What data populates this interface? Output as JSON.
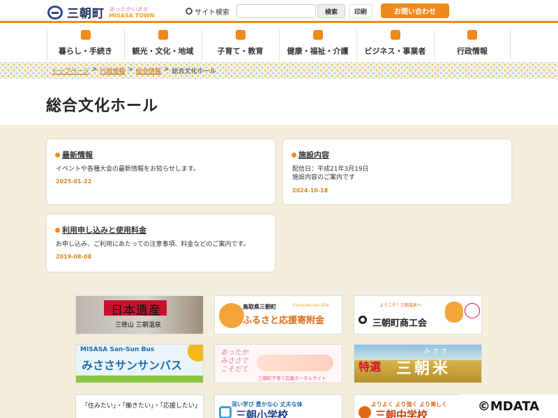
{
  "header": {
    "logo_text": "三朝町",
    "logo_sub1": "あったかいまち",
    "logo_sub2": "MISASA TOWN",
    "search_label": "サイト検索",
    "search_placeholder": "",
    "search_button": "検索",
    "print_button": "印刷",
    "contact_button": "お問い合わせ"
  },
  "nav": [
    {
      "label": "暮らし・手続き",
      "icon": "people-icon"
    },
    {
      "label": "観光・文化・地域",
      "icon": "suitcase-icon"
    },
    {
      "label": "子育て・教育",
      "icon": "family-icon"
    },
    {
      "label": "健康・福祉・介護",
      "icon": "care-icon"
    },
    {
      "label": "ビジネス・事業者",
      "icon": "briefcase-icon"
    },
    {
      "label": "行政情報",
      "icon": "building-icon"
    }
  ],
  "breadcrumb": [
    {
      "label": "トップページ",
      "link": true
    },
    {
      "sep": ">"
    },
    {
      "label": "行政情報",
      "link": true
    },
    {
      "sep": ">"
    },
    {
      "label": "総合情報",
      "link": true
    },
    {
      "sep": ">"
    },
    {
      "label": "総合文化ホール",
      "link": false
    }
  ],
  "page_title": "総合文化ホール",
  "cards": [
    {
      "title": "最新情報",
      "body": [
        "イベントや各種大会の最新情報をお知らせします。"
      ],
      "date": "2025-01-22"
    },
    {
      "title": "施設内容",
      "body": [
        "配信日：平成21年3月19日",
        "施設内容のご案内です"
      ],
      "date": "2024-10-18"
    },
    {
      "title": "利用申し込みと使用料金",
      "body": [
        "お申し込み、ご利用にあたっての注意事項、料金などのご案内です。"
      ],
      "date": "2019-08-08"
    }
  ],
  "banners": {
    "heritage": {
      "t1": "日本遺産",
      "t2": "三徳山 三朝温泉"
    },
    "furusato": {
      "t1": "鳥取県三朝町",
      "t2": "ふるさと応援寄附金",
      "t3": "Furusato-tax-Site"
    },
    "shoko": {
      "t1": "ようこそ！三朝温泉へ",
      "t2": "三朝町商工会"
    },
    "bus": {
      "t1": "MISASA San-Sun Bus",
      "t2": "みささサンサンバス"
    },
    "kosodate": {
      "t1": "あったか みささで こそだて",
      "t2": "三朝町子育て応援ポータルサイト"
    },
    "rice": {
      "t0": "みささ",
      "t1": "特選",
      "t2": "三朝米"
    },
    "sumitai": {
      "t1": "「住みたい」・「働きたい」・「応援したい」"
    },
    "elem": {
      "t1": "深い学び 豊かな心 丈夫な体",
      "t2": "三朝小学校"
    },
    "junior": {
      "t1": "よりよく より強く より美しく",
      "t2": "三朝中学校"
    }
  },
  "copyright": "©MDATA",
  "colors": {
    "accent": "#f0891a",
    "background": "#f3eedd",
    "date": "#d6861a"
  }
}
